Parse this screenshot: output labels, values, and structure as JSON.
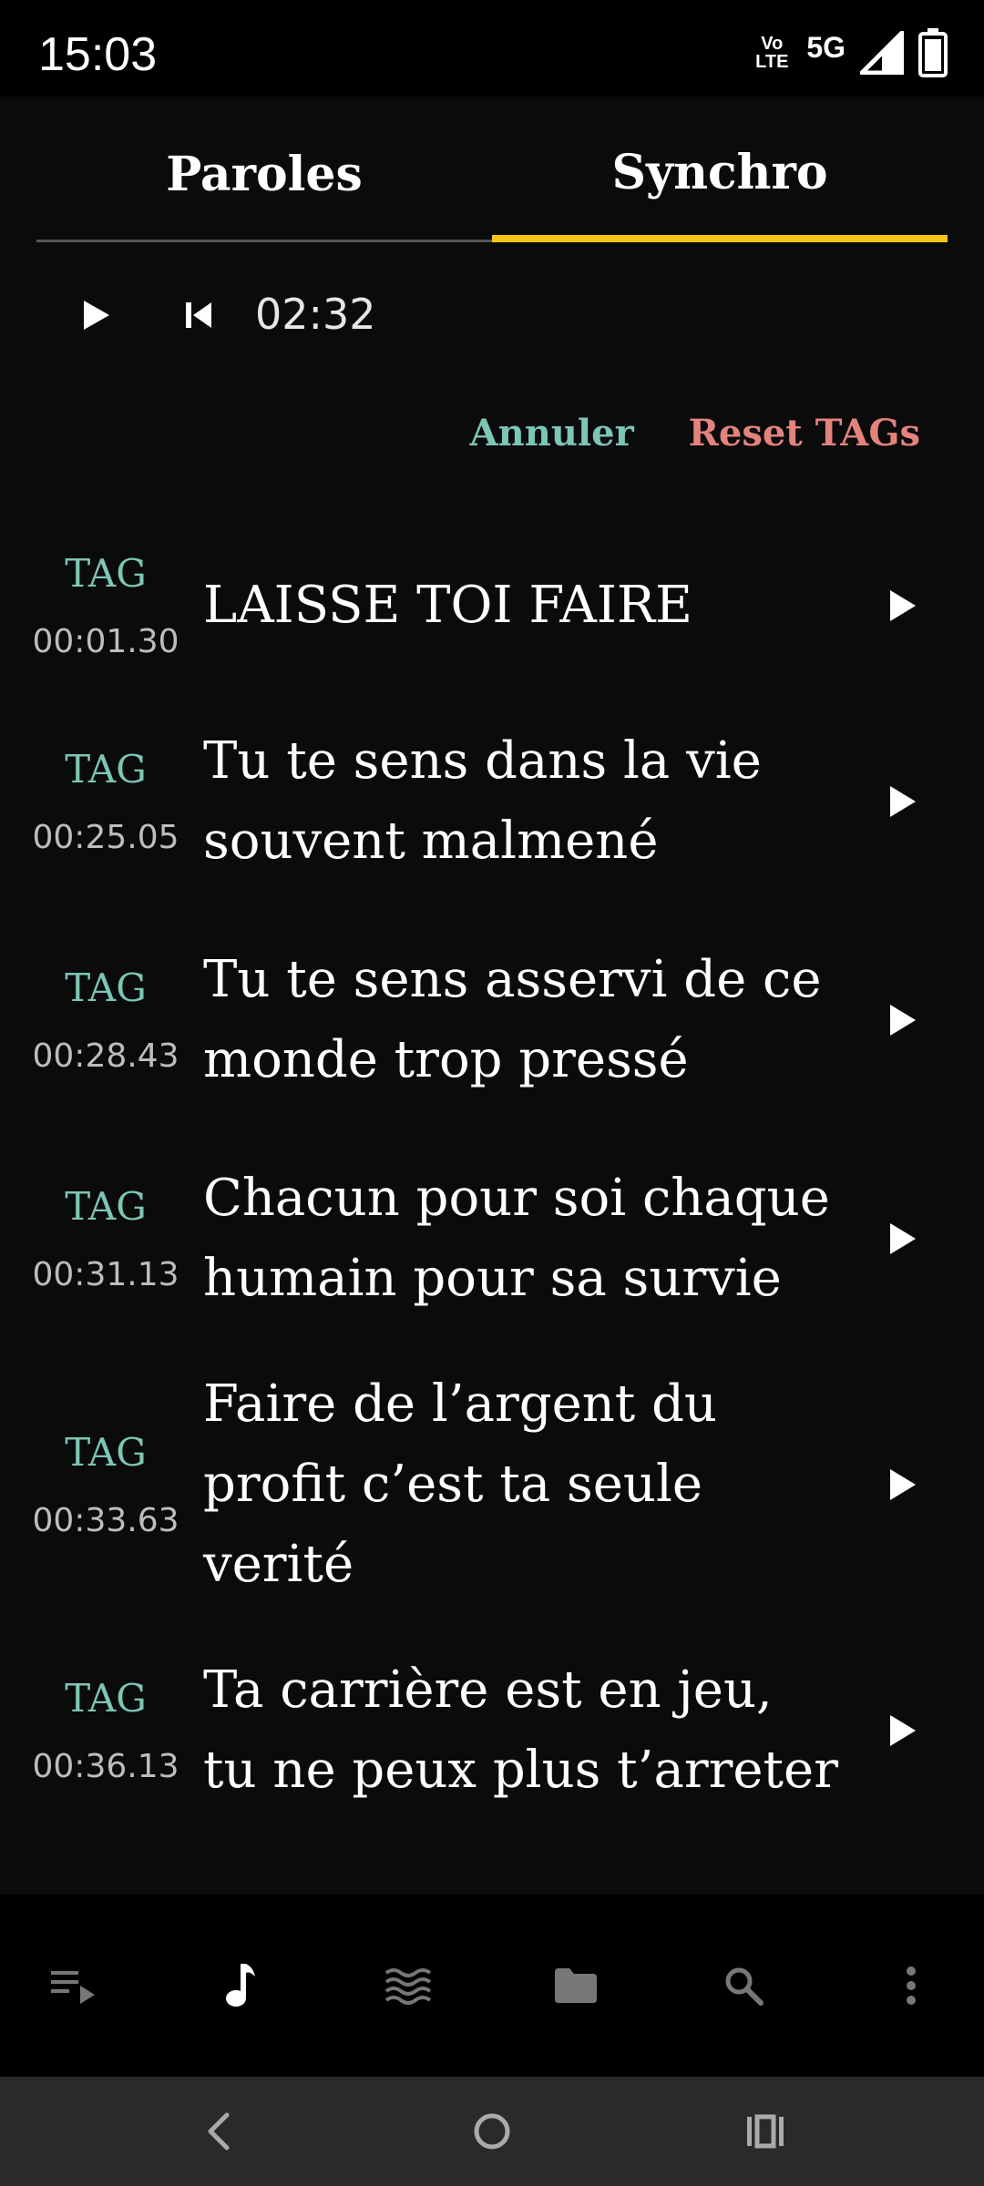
{
  "status_bar": {
    "time": "15:03",
    "volte_label": "Vo LTE",
    "network_label": "5G",
    "icons": [
      "volte-icon",
      "signal-icon",
      "battery-icon"
    ]
  },
  "tabs": [
    {
      "label": "Paroles",
      "active": false
    },
    {
      "label": "Synchro",
      "active": true
    }
  ],
  "player": {
    "time": "02:32",
    "icons": [
      "play-icon",
      "skip-previous-icon"
    ]
  },
  "actions": {
    "cancel_label": "Annuler",
    "reset_label": "Reset TAGs"
  },
  "colors": {
    "accent_tab": "#f5c518",
    "tag_color": "#7dc6b6",
    "reset_color": "#e4837e",
    "background": "#0b0b0b"
  },
  "lyrics": [
    {
      "tag": "TAG",
      "timestamp": "00:01.30",
      "text": "LAISSE TOI FAIRE"
    },
    {
      "tag": "TAG",
      "timestamp": "00:25.05",
      "text": "Tu te sens dans la vie souvent malmené"
    },
    {
      "tag": "TAG",
      "timestamp": "00:28.43",
      "text": "Tu te sens asservi de ce monde trop pressé"
    },
    {
      "tag": "TAG",
      "timestamp": "00:31.13",
      "text": "Chacun pour soi chaque humain pour sa survie"
    },
    {
      "tag": "TAG",
      "timestamp": "00:33.63",
      "text": "Faire de l’argent du profit c’est ta seule verité"
    },
    {
      "tag": "TAG",
      "timestamp": "00:36.13",
      "text": "Ta carrière est en jeu, tu ne peux plus t’arreter"
    }
  ],
  "bottom_nav": [
    "queue-icon",
    "music-note-icon",
    "waves-icon",
    "folder-icon",
    "search-icon",
    "more-vert-icon"
  ],
  "system_nav": [
    "back-icon",
    "home-icon",
    "recents-icon"
  ]
}
